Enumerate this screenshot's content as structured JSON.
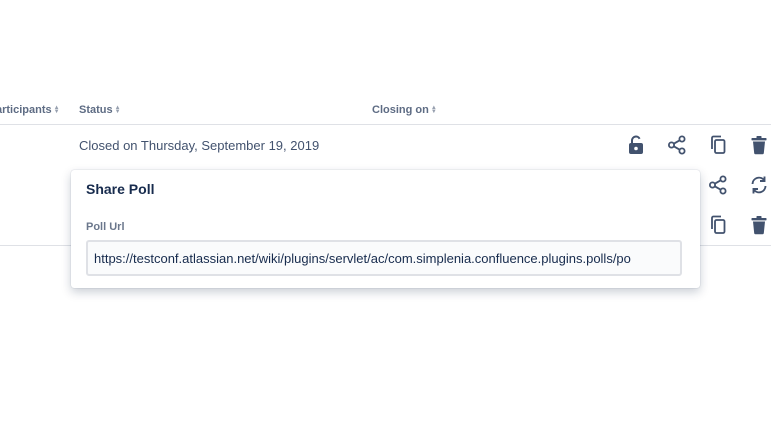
{
  "table": {
    "headers": {
      "participants": "articipants",
      "status": "Status",
      "closing_on": "Closing on"
    },
    "rows": [
      {
        "status": "Closed on Thursday, September 19, 2019",
        "actions": [
          "unlock-icon",
          "share-icon",
          "copy-icon",
          "trash-icon"
        ]
      },
      {
        "status": "",
        "actions": [
          "share-icon",
          "refresh-icon"
        ]
      },
      {
        "status": "",
        "actions": [
          "copy-icon",
          "trash-icon"
        ]
      }
    ]
  },
  "share_popover": {
    "title": "Share Poll",
    "url_label": "Poll Url",
    "url_value": "https://testconf.atlassian.net/wiki/plugins/servlet/ac/com.simplenia.confluence.plugins.polls/po"
  },
  "colors": {
    "icon": "#42526e",
    "header_text": "#5e6c84",
    "divider": "#dfe1e6"
  }
}
